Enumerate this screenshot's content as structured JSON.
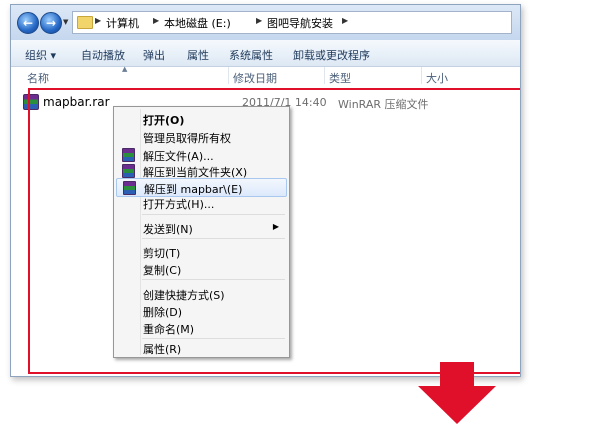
{
  "window": {
    "address": {
      "crumbs": [
        "计算机",
        "本地磁盘 (E:)",
        "图吧导航安装"
      ]
    },
    "toolbar": {
      "items": [
        "组织 ▾",
        "自动播放",
        "弹出",
        "属性",
        "系统属性",
        "卸载或更改程序"
      ]
    },
    "columns": {
      "name": "名称",
      "modified": "修改日期",
      "type": "类型",
      "size": "大小"
    },
    "file": {
      "name": "mapbar.rar",
      "modified": "2011/7/1 14:40",
      "type": "WinRAR 压缩文件"
    }
  },
  "context_menu": {
    "items": [
      {
        "label": "打开(O)"
      },
      {
        "label": "管理员取得所有权"
      },
      {
        "label": "解压文件(A)..."
      },
      {
        "label": "解压到当前文件夹(X)"
      },
      {
        "label": "解压到 mapbar\\(E)"
      },
      {
        "label": "打开方式(H)..."
      },
      {
        "label": "发送到(N)"
      },
      {
        "label": "剪切(T)"
      },
      {
        "label": "复制(C)"
      },
      {
        "label": "创建快捷方式(S)"
      },
      {
        "label": "删除(D)"
      },
      {
        "label": "重命名(M)"
      },
      {
        "label": "属性(R)"
      }
    ]
  },
  "colors": {
    "highlight_border": "#e0102a",
    "arrow": "#e0102a"
  }
}
